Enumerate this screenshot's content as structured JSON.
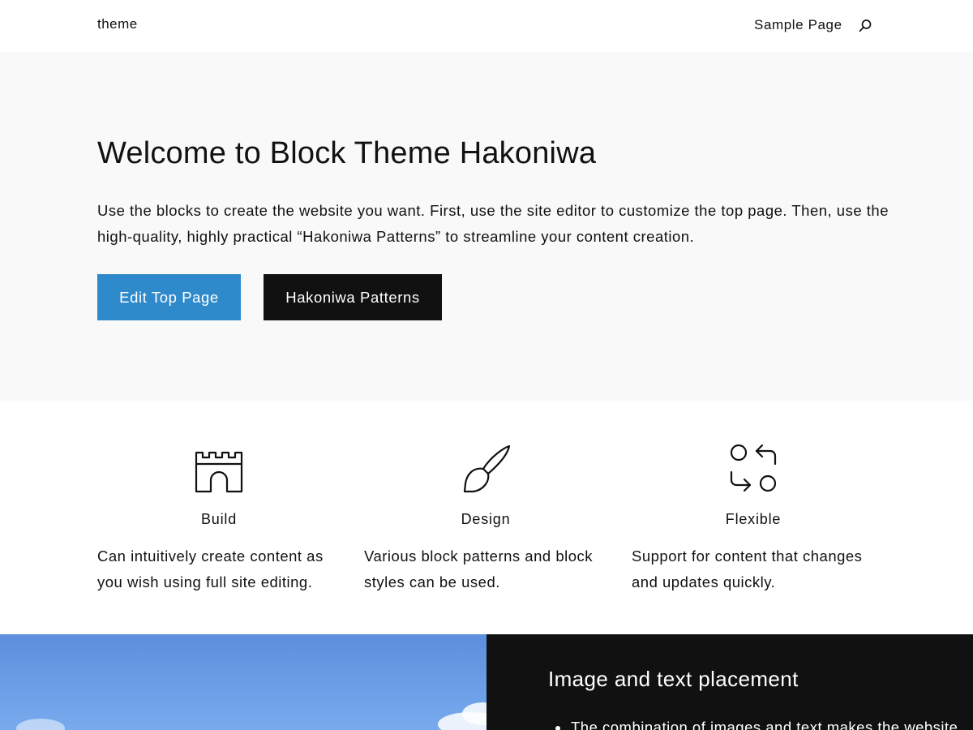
{
  "header": {
    "site_title": "theme",
    "nav": [
      {
        "label": "Sample Page"
      }
    ],
    "search_icon": "search-icon"
  },
  "hero": {
    "title": "Welcome to Block Theme Hakoniwa",
    "text": "Use the blocks to create the website you want. First, use the site editor to customize the top page. Then, use the high-quality, highly practical “Hakoniwa Patterns” to streamline your content creation.",
    "buttons": [
      {
        "label": "Edit Top Page",
        "color": "#2f8acb"
      },
      {
        "label": "Hakoniwa Patterns",
        "color": "#111111"
      }
    ],
    "background": "#f9f9f9"
  },
  "features": [
    {
      "icon": "castle-icon",
      "title": "Build",
      "text": "Can intuitively create content as you wish using full site editing."
    },
    {
      "icon": "brush-icon",
      "title": "Design",
      "text": "Various block patterns and block styles can be used."
    },
    {
      "icon": "flexible-arrows-icon",
      "title": "Flexible",
      "text": "Support for content that changes and updates quickly."
    }
  ],
  "media_text": {
    "image": "sky-photo",
    "title": "Image and text placement",
    "list": [
      "The combination of images and text makes the website"
    ],
    "background": "#111111"
  }
}
